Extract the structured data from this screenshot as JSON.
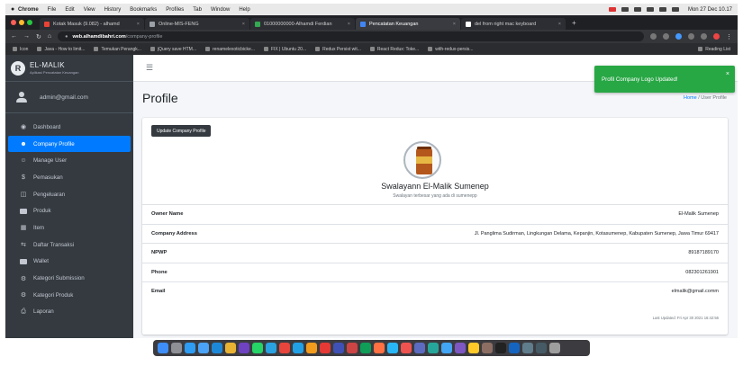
{
  "menubar": {
    "app": "Chrome",
    "items": [
      "File",
      "Edit",
      "View",
      "History",
      "Bookmarks",
      "Profiles",
      "Tab",
      "Window",
      "Help"
    ],
    "clock": "Mon 27 Dec 10.17"
  },
  "tabs": [
    {
      "label": "Kotak Masuk (9.082) - alhamd",
      "fav_color": "#ea4335"
    },
    {
      "label": "Online-MIS-FENG",
      "fav_color": "#9aa0a6"
    },
    {
      "label": "01000000000-Alhamdi Ferdian",
      "fav_color": "#34a853"
    },
    {
      "label": "Pencatatan Keuangan",
      "fav_color": "#4285f4",
      "active": true
    },
    {
      "label": "del from right mac keyboard",
      "fav_color": "#ffffff"
    }
  ],
  "address": {
    "host": "web.alhamdibahri.com",
    "path": "/company-profile"
  },
  "bookmarks": [
    "Icon",
    "Java - How to limit...",
    "Temukan Perangk...",
    "jQuery save HTM...",
    "renamelexoticbicke...",
    "FIX | Ubuntu 20...",
    "Redux Persist wit...",
    "React Redux: Toke...",
    "with-redux-persis...",
    "Reading List"
  ],
  "sidebar": {
    "brand_title": "EL-MALIK",
    "brand_sub": "Aplikasi Pencatatan Keuangan",
    "user": "admin@gmail.com",
    "items": [
      {
        "label": "Dashboard",
        "icon": "dashboard-icon"
      },
      {
        "label": "Company Profile",
        "icon": "user-icon",
        "active": true
      },
      {
        "label": "Manage User",
        "icon": "users-icon"
      },
      {
        "label": "Pemasukan",
        "icon": "dollar-icon"
      },
      {
        "label": "Pengeluaran",
        "icon": "cart-icon"
      },
      {
        "label": "Produk",
        "icon": "box-icon"
      },
      {
        "label": "Item",
        "icon": "cubes-icon"
      },
      {
        "label": "Daftar Transaksi",
        "icon": "exchange-icon"
      },
      {
        "label": "Wallet",
        "icon": "wallet-icon"
      },
      {
        "label": "Kategori Submission",
        "icon": "gear-icon"
      },
      {
        "label": "Kategori Produk",
        "icon": "gear-icon"
      },
      {
        "label": "Laporan",
        "icon": "print-icon"
      }
    ]
  },
  "header": {
    "title": "Profile",
    "breadcrumb_home": "Home",
    "breadcrumb_sep": "/",
    "breadcrumb_current": "User Profile"
  },
  "profile": {
    "update_button": "Update Company Profile",
    "company_name": "Swalayann El-Malik Sumenep",
    "tagline": "Swalayan terbesar yang ada di sumenepp",
    "rows": [
      {
        "label": "Owner Name",
        "value": "El-Malik Sumenep"
      },
      {
        "label": "Company Address",
        "value": "Jl. Panglima Sudirman, Lingkungan Delama, Kepanjin, Kotasumenep, Kabupaten Sumenep, Jawa Timur 69417"
      },
      {
        "label": "NPWP",
        "value": "89187189170"
      },
      {
        "label": "Phone",
        "value": "082301261901"
      },
      {
        "label": "Email",
        "value": "elmalik@gmail.comm"
      }
    ],
    "last_updated": "Last Updated: Fri Apr 30 2021 16:42:56"
  },
  "toast": {
    "message": "Profil Company Logo Updated!",
    "close": "×",
    "color": "#28a745"
  },
  "colors": {
    "sidebar": "#343a40",
    "accent": "#007bff"
  }
}
